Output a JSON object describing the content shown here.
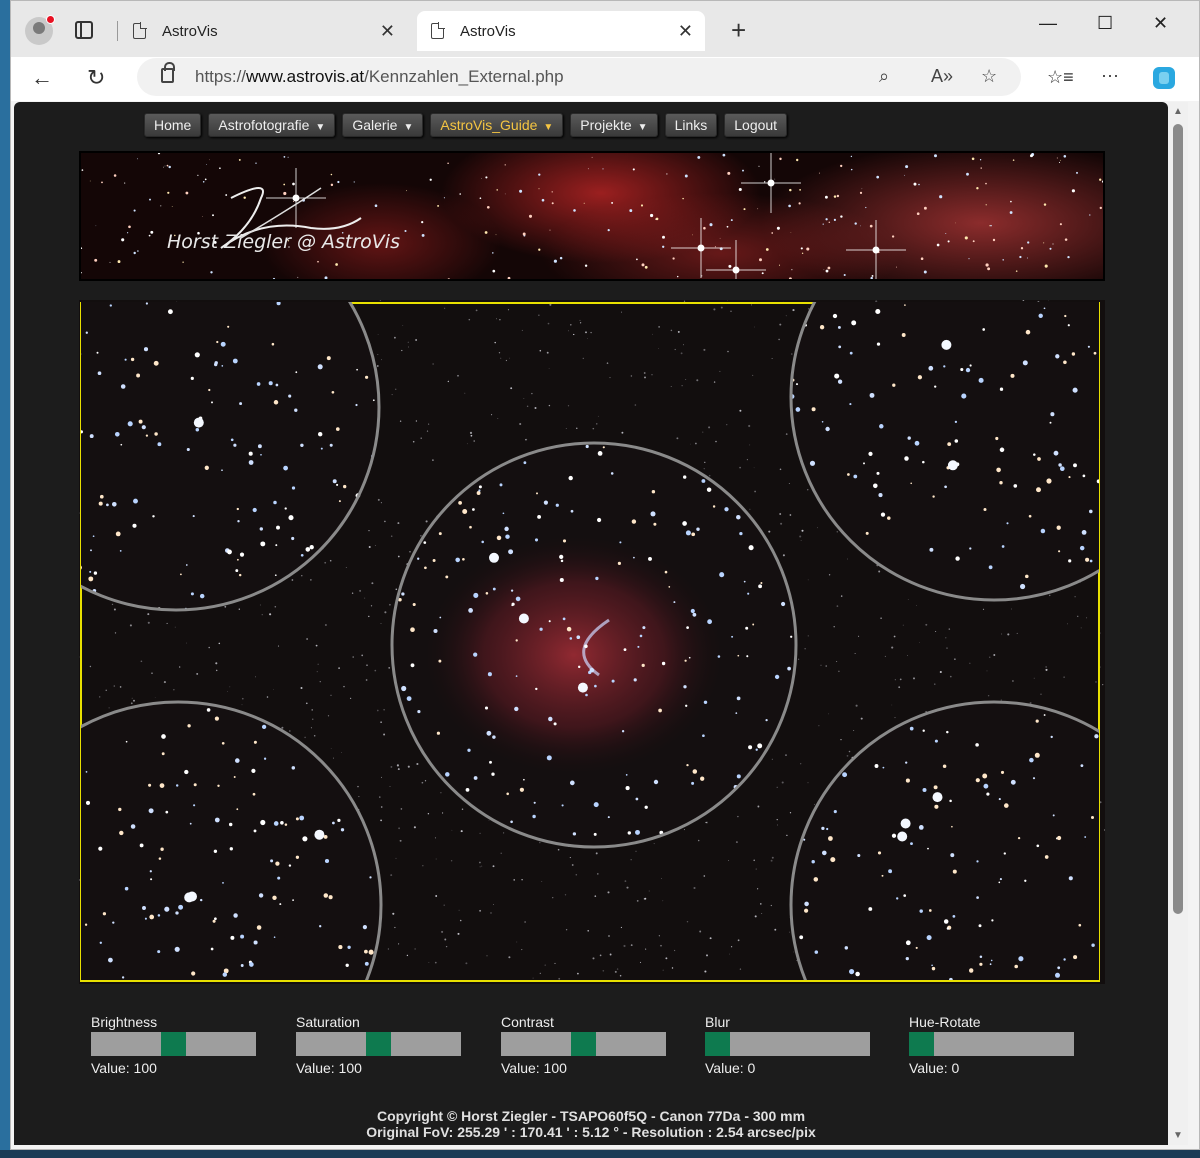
{
  "browser": {
    "tabs": [
      {
        "title": "AstroVis",
        "active": false
      },
      {
        "title": "AstroVis",
        "active": true
      }
    ],
    "new_tab": "+",
    "address": {
      "prefix": "https://",
      "host": "www.astrovis.at",
      "path": "/Kennzahlen_External.php"
    },
    "icons": [
      "back-icon",
      "refresh-icon",
      "lock-icon",
      "zoom-icon",
      "read-aloud-icon",
      "favorite-icon",
      "favorites-list-icon",
      "more-icon",
      "copilot-icon"
    ]
  },
  "site_menu": [
    {
      "label": "Home",
      "dropdown": false,
      "highlight": false
    },
    {
      "label": "Astrofotografie",
      "dropdown": true,
      "highlight": false
    },
    {
      "label": "Galerie",
      "dropdown": true,
      "highlight": false
    },
    {
      "label": "AstroVis_Guide",
      "dropdown": true,
      "highlight": true
    },
    {
      "label": "Projekte",
      "dropdown": true,
      "highlight": false
    },
    {
      "label": "Links",
      "dropdown": false,
      "highlight": false
    },
    {
      "label": "Logout",
      "dropdown": false,
      "highlight": false
    }
  ],
  "banner": {
    "signature": "Horst Ziegler @ AstroVis"
  },
  "controls": [
    {
      "label": "Brightness",
      "value_text": "Value: 100",
      "level": 0.5
    },
    {
      "label": "Saturation",
      "value_text": "Value: 100",
      "level": 0.5
    },
    {
      "label": "Contrast",
      "value_text": "Value: 100",
      "level": 0.5
    },
    {
      "label": "Blur",
      "value_text": "Value: 0",
      "level": 0.0
    },
    {
      "label": "Hue-Rotate",
      "value_text": "Value: 0",
      "level": 0.0
    }
  ],
  "footer": {
    "line1": "Copyright © Horst Ziegler - TSAPO60f5Q - Canon 77Da - 300 mm",
    "line2": "Original FoV: 255.29 ' : 170.41 ' : 5.12 ° - Resolution : 2.54 arcsec/pix"
  },
  "colors": {
    "accent_knob": "#0e7a4f",
    "frame_yellow": "#e8e000",
    "circle_gray": "#8a8a8a",
    "menu_highlight": "#f5c542"
  }
}
